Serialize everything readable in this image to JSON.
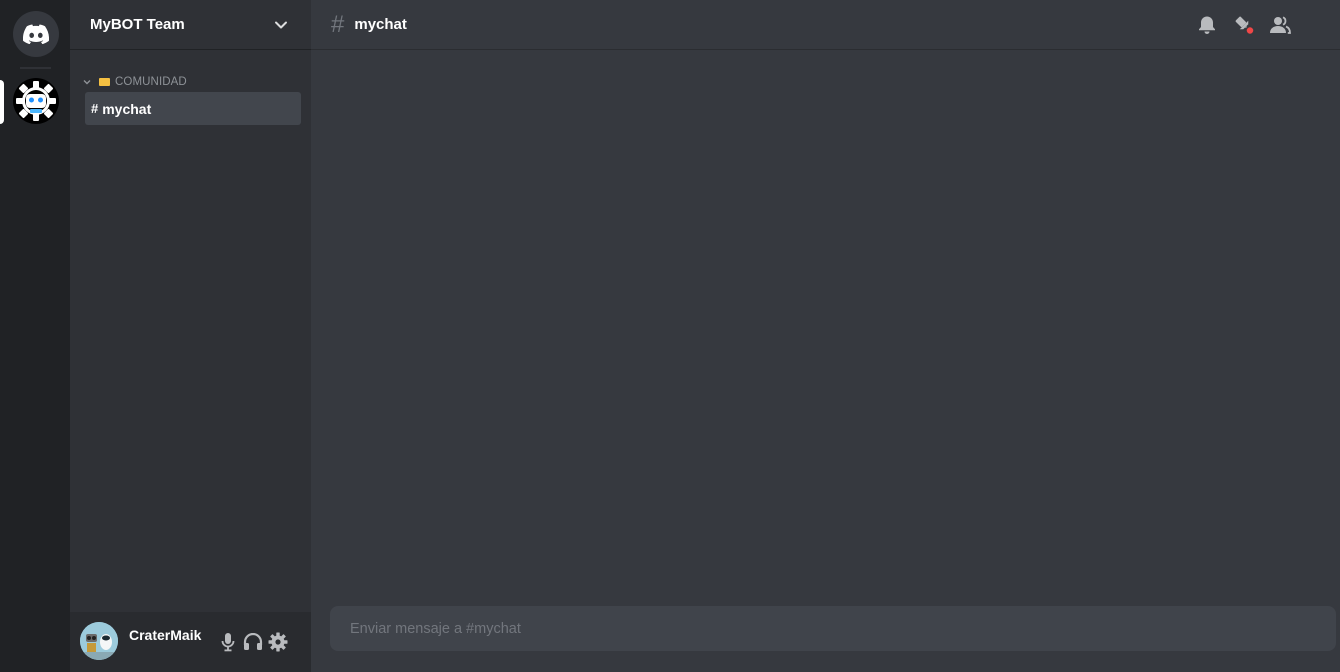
{
  "server": {
    "name": "MyBOT Team"
  },
  "sidebar": {
    "categories": [
      {
        "label": "COMUNIDAD",
        "channels": [
          {
            "hash": "#",
            "name": "mychat",
            "selected": true
          }
        ]
      }
    ]
  },
  "user": {
    "name": "CraterMaik"
  },
  "chat": {
    "hash": "#",
    "title": "mychat"
  },
  "composer": {
    "placeholder": "Enviar mensaje a #mychat"
  },
  "icons": {
    "home": "discord-logo-icon",
    "server": "robot-gear-icon",
    "chevron": "chevron-down-icon",
    "bell": "bell-icon",
    "pin": "pin-icon",
    "members": "members-icon",
    "mic": "microphone-icon",
    "headphones": "headphones-icon",
    "settings": "gear-icon"
  },
  "colors": {
    "accent_unread_dot": "#f04747",
    "folder": "#f5c042"
  }
}
